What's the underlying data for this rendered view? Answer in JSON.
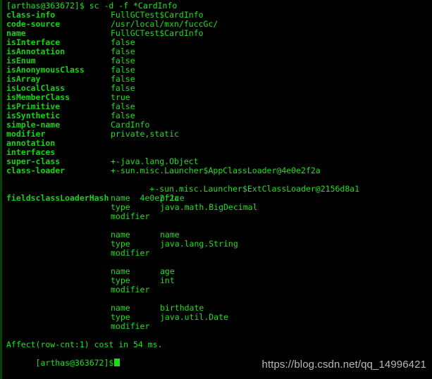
{
  "terminal": {
    "prompt": "[arthas@363672]$",
    "command_line": "[arthas@363672]$ sc -d -f *CardInfo",
    "command": "sc -d -f *CardInfo",
    "colors": {
      "background": "#000000",
      "text_green": "#22dd22",
      "label_green": "#15d415",
      "prompt_green": "#1ee41e",
      "border_green": "#0a3d0a",
      "watermark_gray": "#b9b9b9"
    }
  },
  "class_info": [
    {
      "key": "class-info",
      "value": "FullGCTest$CardInfo"
    },
    {
      "key": "code-source",
      "value": "/usr/local/mxn/fuccGc/"
    },
    {
      "key": "name",
      "value": "FullGCTest$CardInfo"
    },
    {
      "key": "isInterface",
      "value": "false"
    },
    {
      "key": "isAnnotation",
      "value": "false"
    },
    {
      "key": "isEnum",
      "value": "false"
    },
    {
      "key": "isAnonymousClass",
      "value": "false"
    },
    {
      "key": "isArray",
      "value": "false"
    },
    {
      "key": "isLocalClass",
      "value": "false"
    },
    {
      "key": "isMemberClass",
      "value": "true"
    },
    {
      "key": "isPrimitive",
      "value": "false"
    },
    {
      "key": "isSynthetic",
      "value": "false"
    },
    {
      "key": "simple-name",
      "value": "CardInfo"
    },
    {
      "key": "modifier",
      "value": "private,static"
    },
    {
      "key": "annotation",
      "value": ""
    },
    {
      "key": "interfaces",
      "value": ""
    },
    {
      "key": "super-class",
      "value": "+-java.lang.Object"
    },
    {
      "key": "class-loader",
      "value": "+-sun.misc.Launcher$AppClassLoader@4e0e2f2a"
    }
  ],
  "class_loader_continuation": "  +-sun.misc.Launcher$ExtClassLoader@2156d8a1",
  "class_loader_hash": {
    "key": "classLoaderHash",
    "value": "4e0e2f2a"
  },
  "fields_label": "fields",
  "fields": [
    {
      "rows": [
        {
          "name": "name",
          "value": "price"
        },
        {
          "name": "type",
          "value": "java.math.BigDecimal"
        },
        {
          "name": "modifier",
          "value": ""
        }
      ]
    },
    {
      "rows": [
        {
          "name": "name",
          "value": "name"
        },
        {
          "name": "type",
          "value": "java.lang.String"
        },
        {
          "name": "modifier",
          "value": ""
        }
      ]
    },
    {
      "rows": [
        {
          "name": "name",
          "value": "age"
        },
        {
          "name": "type",
          "value": "int"
        },
        {
          "name": "modifier",
          "value": ""
        }
      ]
    },
    {
      "rows": [
        {
          "name": "name",
          "value": "birthdate"
        },
        {
          "name": "type",
          "value": "java.util.Date"
        },
        {
          "name": "modifier",
          "value": ""
        }
      ]
    }
  ],
  "footer": {
    "affect": "Affect(row-cnt:1) cost in 54 ms.",
    "prompt": "[arthas@363672]$"
  },
  "watermark": "https://blog.csdn.net/qq_14996421"
}
